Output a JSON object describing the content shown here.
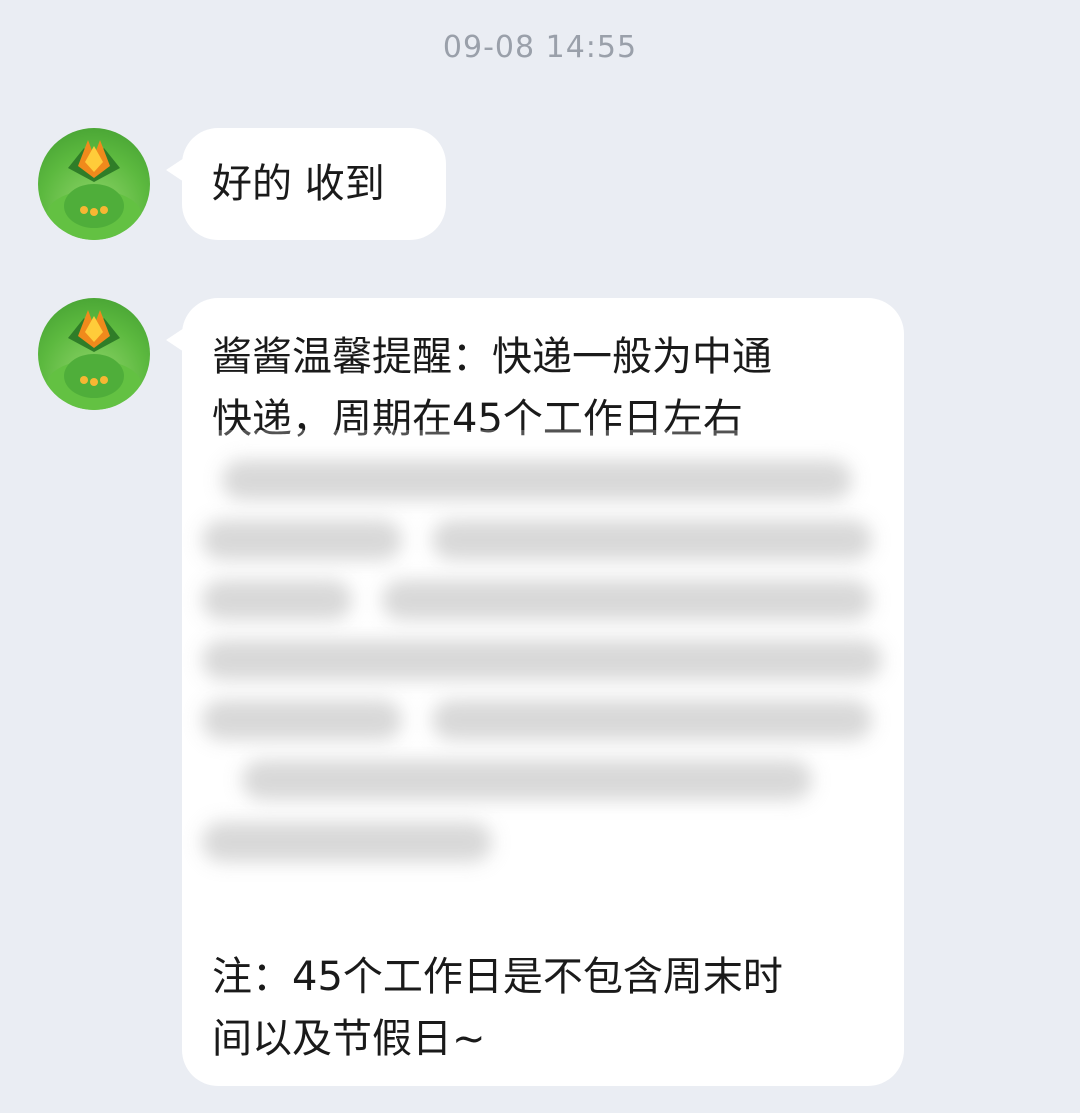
{
  "timestamp": "09-08 14:55",
  "messages": [
    {
      "sender_avatar": "plant-creature-avatar",
      "text": "好的 收到"
    },
    {
      "sender_avatar": "plant-creature-avatar",
      "lines": [
        "酱酱温馨提醒：快递一般为中通",
        "快递，周期在45个工作日左右"
      ],
      "note_lines": [
        "注：45个工作日是不包含周末时",
        "间以及节假日~"
      ]
    }
  ],
  "colors": {
    "background": "#eaedf3",
    "bubble": "#ffffff",
    "timestamp": "#9aa0aa",
    "text": "#1a1a1a"
  }
}
